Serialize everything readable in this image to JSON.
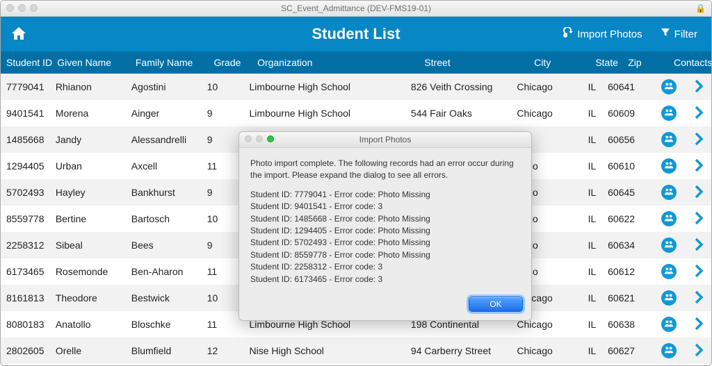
{
  "window": {
    "title": "SC_Event_Admittance (DEV-FMS19-01)"
  },
  "header": {
    "title": "Student List",
    "import_label": "Import Photos",
    "filter_label": "Filter"
  },
  "columns": {
    "id": "Student ID",
    "given": "Given Name",
    "family": "Family Name",
    "grade": "Grade",
    "org": "Organization",
    "street": "Street",
    "city": "City",
    "state": "State",
    "zip": "Zip",
    "contacts": "Contacts"
  },
  "rows": [
    {
      "id": "7779041",
      "given": "Rhianon",
      "family": "Agostini",
      "grade": "10",
      "org": "Limbourne High School",
      "street": "826 Veith Crossing",
      "city": "Chicago",
      "state": "IL",
      "zip": "60641"
    },
    {
      "id": "9401541",
      "given": "Morena",
      "family": "Ainger",
      "grade": "9",
      "org": "Limbourne High School",
      "street": "544 Fair Oaks",
      "city": "Chicago",
      "state": "IL",
      "zip": "60609"
    },
    {
      "id": "1485668",
      "given": "Jandy",
      "family": "Alessandrelli",
      "grade": "9",
      "org": "",
      "street": "",
      "city": "",
      "state": "IL",
      "zip": "60656"
    },
    {
      "id": "1294405",
      "given": "Urban",
      "family": "Axcell",
      "grade": "11",
      "org": "",
      "street": "",
      "city": "cago",
      "state": "IL",
      "zip": "60610"
    },
    {
      "id": "5702493",
      "given": "Hayley",
      "family": "Bankhurst",
      "grade": "9",
      "org": "",
      "street": "",
      "city": "cago",
      "state": "IL",
      "zip": "60645"
    },
    {
      "id": "8559778",
      "given": "Bertine",
      "family": "Bartosch",
      "grade": "10",
      "org": "",
      "street": "",
      "city": "cago",
      "state": "IL",
      "zip": "60622"
    },
    {
      "id": "2258312",
      "given": "Sibeal",
      "family": "Bees",
      "grade": "9",
      "org": "",
      "street": "",
      "city": "cago",
      "state": "IL",
      "zip": "60634"
    },
    {
      "id": "6173465",
      "given": "Rosemonde",
      "family": "Ben-Aharon",
      "grade": "11",
      "org": "",
      "street": "",
      "city": "cago",
      "state": "IL",
      "zip": "60612"
    },
    {
      "id": "8161813",
      "given": "Theodore",
      "family": "Bestwick",
      "grade": "10",
      "org": "Irons High School",
      "street": "78 Lakeland Circle",
      "city": "Chicago",
      "state": "IL",
      "zip": "60621"
    },
    {
      "id": "8080183",
      "given": "Anatollo",
      "family": "Bloschke",
      "grade": "11",
      "org": "Limbourne High School",
      "street": "198 Continental",
      "city": "Chicago",
      "state": "IL",
      "zip": "60638"
    },
    {
      "id": "2802605",
      "given": "Orelle",
      "family": "Blumfield",
      "grade": "12",
      "org": "Nise High School",
      "street": "94 Carberry Street",
      "city": "Chicago",
      "state": "IL",
      "zip": "60627"
    }
  ],
  "dialog": {
    "title": "Import Photos",
    "message": "Photo import complete.  The following records had an error occur during the import.  Please expand the dialog to see all errors.",
    "errors": [
      "Student ID: 7779041 - Error code: Photo Missing",
      "Student ID: 9401541 - Error code: 3",
      "Student ID: 1485668 - Error code: Photo Missing",
      "Student ID: 1294405 - Error code: Photo Missing",
      "Student ID: 5702493 - Error code: Photo Missing",
      "Student ID: 8559778 - Error code: Photo Missing",
      "Student ID: 2258312 - Error code: 3",
      "Student ID: 6173465 - Error code: 3"
    ],
    "ok_label": "OK"
  }
}
